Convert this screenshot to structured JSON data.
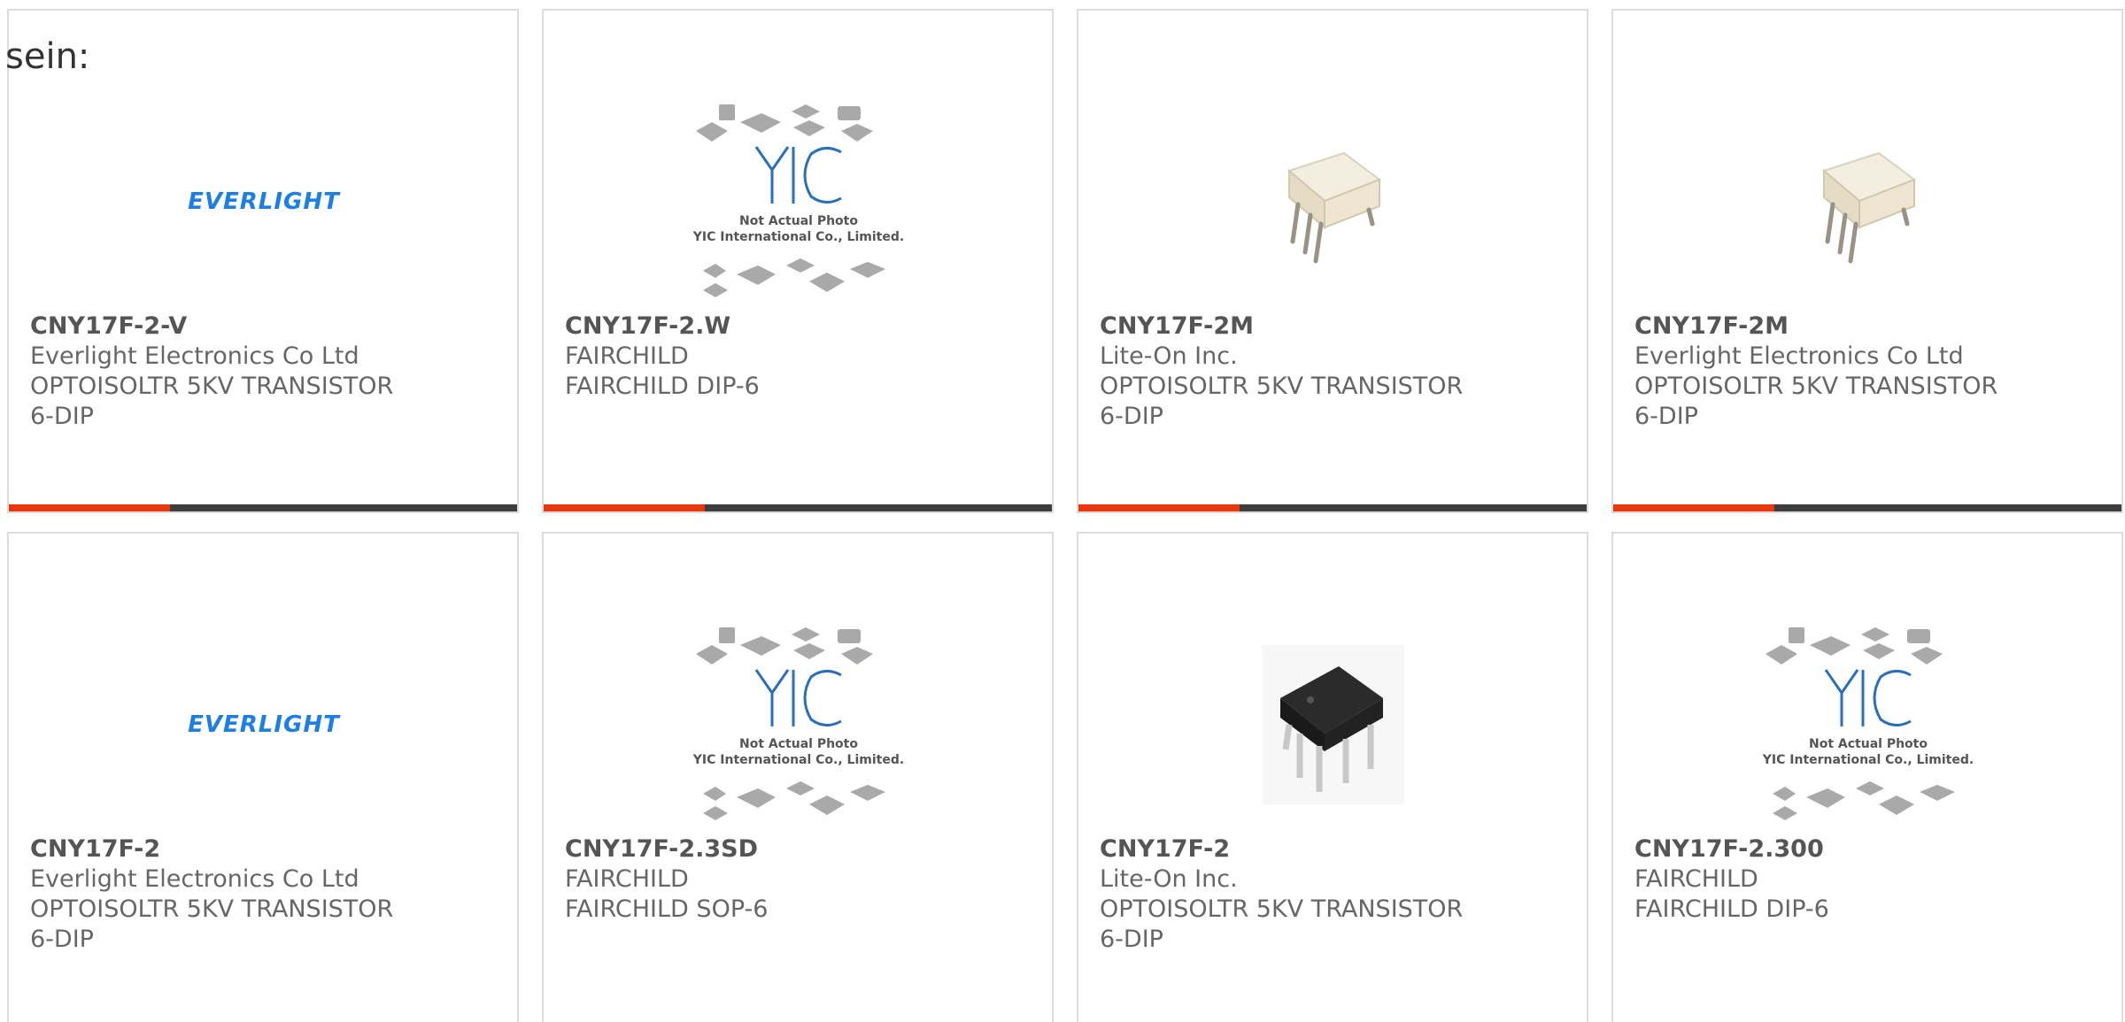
{
  "intro_text": "sein:",
  "colors": {
    "accent": "#e8380d",
    "bar": "#3d3d3d",
    "everlight_blue": "#1d7fe3",
    "yic_blue": "#2a6fb8"
  },
  "placeholder": {
    "line1": "Not Actual Photo",
    "line2": "YIC International Co., Limited."
  },
  "products": [
    {
      "part": "CNY17F-2-V",
      "maker": "Everlight Electronics Co Ltd",
      "desc": "OPTOISOLTR 5KV TRANSISTOR",
      "package": "6-DIP",
      "image": "everlight-logo",
      "logo_text": "EVERLIGHT"
    },
    {
      "part": "CNY17F-2.W",
      "maker": "FAIRCHILD",
      "desc": "FAIRCHILD DIP-6",
      "package": "",
      "image": "yic-placeholder"
    },
    {
      "part": "CNY17F-2M",
      "maker": "Lite-On Inc.",
      "desc": "OPTOISOLTR 5KV TRANSISTOR",
      "package": "6-DIP",
      "image": "white-dip-chip"
    },
    {
      "part": "CNY17F-2M",
      "maker": "Everlight Electronics Co Ltd",
      "desc": "OPTOISOLTR 5KV TRANSISTOR",
      "package": "6-DIP",
      "image": "white-dip-chip"
    },
    {
      "part": "CNY17F-2",
      "maker": "Everlight Electronics Co Ltd",
      "desc": "OPTOISOLTR 5KV TRANSISTOR",
      "package": "6-DIP",
      "image": "everlight-logo",
      "logo_text": "EVERLIGHT"
    },
    {
      "part": "CNY17F-2.3SD",
      "maker": "FAIRCHILD",
      "desc": "FAIRCHILD SOP-6",
      "package": "",
      "image": "yic-placeholder"
    },
    {
      "part": "CNY17F-2",
      "maker": "Lite-On Inc.",
      "desc": "OPTOISOLTR 5KV TRANSISTOR",
      "package": "6-DIP",
      "image": "black-dip-chip"
    },
    {
      "part": "CNY17F-2.300",
      "maker": "FAIRCHILD",
      "desc": "FAIRCHILD DIP-6",
      "package": "",
      "image": "yic-placeholder"
    }
  ]
}
